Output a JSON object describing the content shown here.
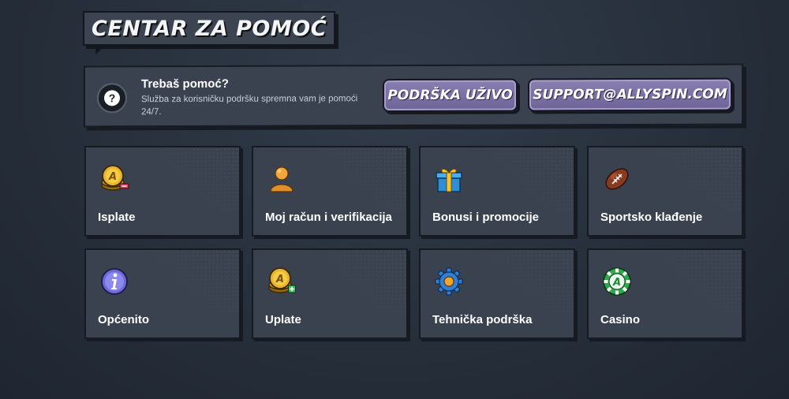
{
  "header": {
    "title": "CENTAR ZA POMOĆ"
  },
  "help": {
    "icon": "question-icon",
    "title": "Trebaš pomoć?",
    "description": "Služba za korisničku podršku spremna vam je pomoći 24/7.",
    "live_button": "PODRŠKA UŽIVO",
    "email_button": "SUPPORT@ALLYSPIN.COM",
    "button_color": "#7d72a8"
  },
  "categories": [
    {
      "label": "Isplate",
      "icon": "coin-withdraw-icon"
    },
    {
      "label": "Moj račun i verifikacija",
      "icon": "user-icon"
    },
    {
      "label": "Bonusi i promocije",
      "icon": "gift-icon"
    },
    {
      "label": "Sportsko klađenje",
      "icon": "football-icon"
    },
    {
      "label": "Općenito",
      "icon": "info-icon"
    },
    {
      "label": "Uplate",
      "icon": "coin-deposit-icon"
    },
    {
      "label": "Tehnička podrška",
      "icon": "gear-icon"
    },
    {
      "label": "Casino",
      "icon": "casino-chip-icon"
    }
  ]
}
